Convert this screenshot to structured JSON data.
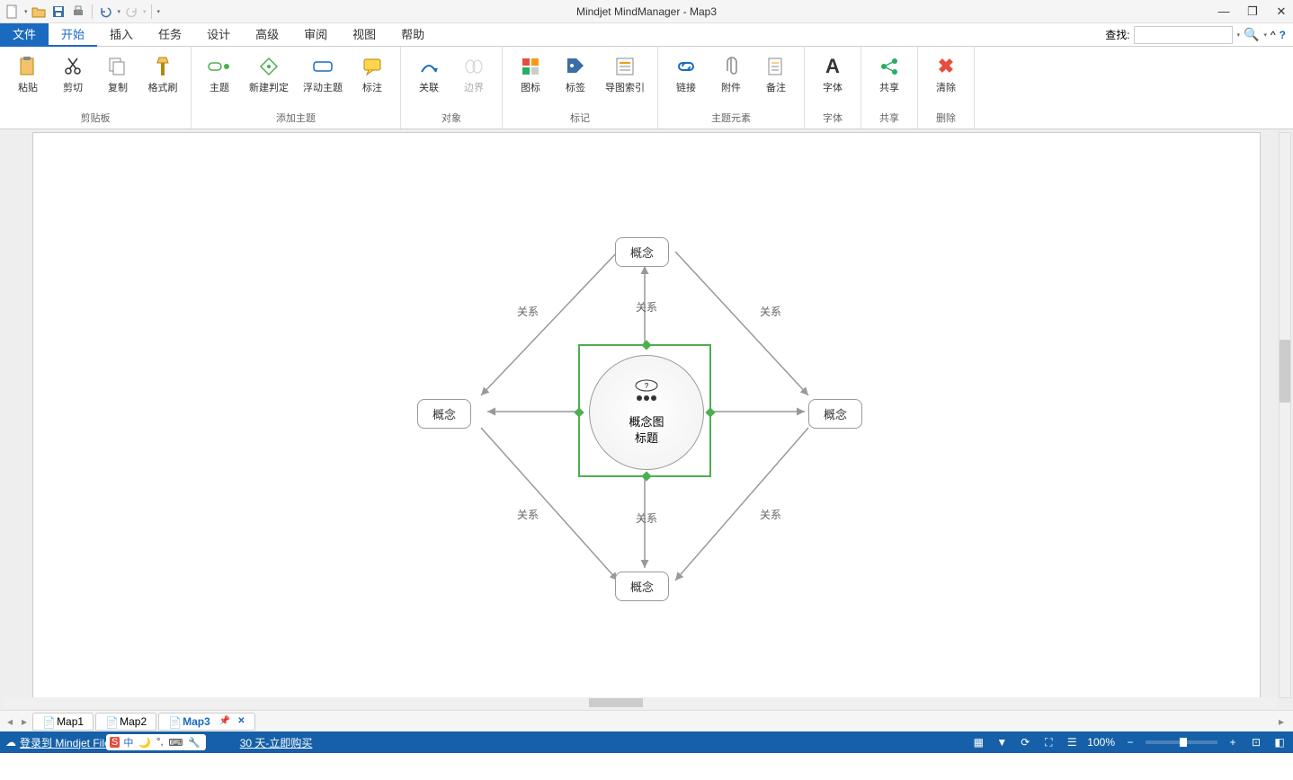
{
  "title": "Mindjet MindManager - Map3",
  "tabs": {
    "file": "文件",
    "start": "开始",
    "insert": "插入",
    "task": "任务",
    "design": "设计",
    "advanced": "高级",
    "review": "审阅",
    "view": "视图",
    "help": "帮助"
  },
  "search_label": "查找:",
  "ribbon": {
    "paste": "粘贴",
    "cut": "剪切",
    "copy": "复制",
    "format_painter": "格式刷",
    "group_clipboard": "剪贴板",
    "topic": "主题",
    "new_decision": "新建判定",
    "float_topic": "浮动主题",
    "callout": "标注",
    "group_add_topic": "添加主题",
    "relation": "关联",
    "boundary": "边界",
    "group_object": "对象",
    "icon": "图标",
    "tag": "标签",
    "map_index": "导图索引",
    "group_mark": "标记",
    "link": "链接",
    "attachment": "附件",
    "note": "备注",
    "group_elements": "主题元素",
    "font": "字体",
    "group_font": "字体",
    "share": "共享",
    "group_share": "共享",
    "clear": "清除",
    "group_delete": "删除"
  },
  "map": {
    "concept": "概念",
    "relation": "关系",
    "center_line1": "概念图",
    "center_line2": "标题"
  },
  "doc_tabs": {
    "map1": "Map1",
    "map2": "Map2",
    "map3": "Map3"
  },
  "status": {
    "login": "登录到 Mindjet File",
    "trial": "30 天-立即购买",
    "zoom": "100%",
    "ime_cn": "中"
  }
}
